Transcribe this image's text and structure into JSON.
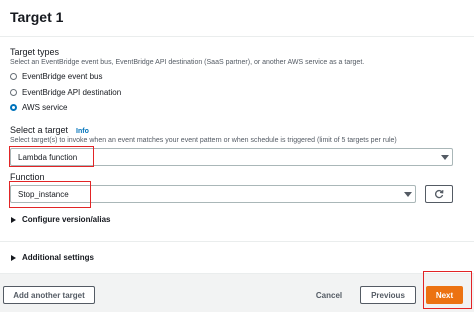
{
  "card": {
    "title": "Target 1"
  },
  "target_types": {
    "label": "Target types",
    "description": "Select an EventBridge event bus, EventBridge API destination (SaaS partner), or another AWS service as a target.",
    "options": [
      {
        "label": "EventBridge event bus",
        "selected": false
      },
      {
        "label": "EventBridge API destination",
        "selected": false
      },
      {
        "label": "AWS service",
        "selected": true
      }
    ]
  },
  "select_target": {
    "label": "Select a target",
    "info": "Info",
    "description": "Select target(s) to invoke when an event matches your event pattern or when schedule is triggered (limit of 5 targets per rule)",
    "value": "Lambda function"
  },
  "function": {
    "label": "Function",
    "value": "Stop_instance"
  },
  "configure_version": {
    "label": "Configure version/alias"
  },
  "additional_settings": {
    "label": "Additional settings"
  },
  "footer": {
    "add_target": "Add another target",
    "cancel": "Cancel",
    "previous": "Previous",
    "next": "Next"
  },
  "colors": {
    "primary": "#ec7211",
    "highlight": "#e22426",
    "link": "#0073bb"
  },
  "icons": [
    "chevron-down-icon",
    "refresh-icon",
    "caret-right-icon"
  ]
}
